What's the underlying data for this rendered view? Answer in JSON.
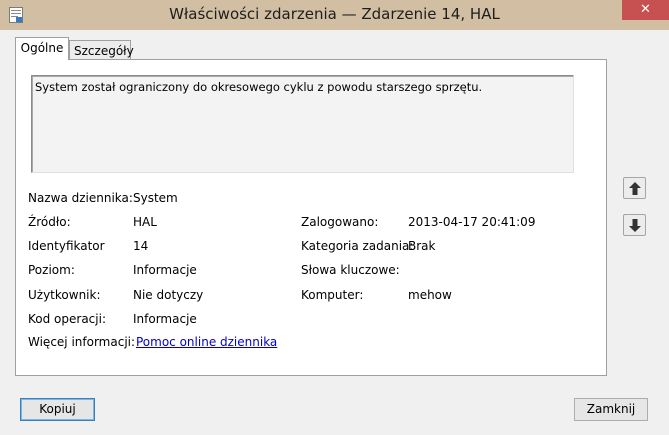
{
  "window": {
    "title": "Właściwości zdarzenia — Zdarzenie 14, HAL",
    "close_glyph": "✕"
  },
  "tabs": [
    {
      "label": "Ogólne"
    },
    {
      "label": "Szczegóły"
    }
  ],
  "description": "System został ograniczony do okresowego cyklu z powodu starszego sprzętu.",
  "fields_left": [
    {
      "label": "Nazwa dziennika:",
      "value": "System"
    },
    {
      "label": "Źródło:",
      "value": "HAL"
    },
    {
      "label": "Identyfikator",
      "value": "14"
    },
    {
      "label": "Poziom:",
      "value": "Informacje"
    },
    {
      "label": "Użytkownik:",
      "value": "Nie dotyczy"
    },
    {
      "label": "Kod operacji:",
      "value": "Informacje"
    },
    {
      "label": "Więcej informacji:",
      "value": "Pomoc online dziennika"
    }
  ],
  "fields_right": [
    {
      "label": "Zalogowano:",
      "value": "2013-04-17 20:41:09"
    },
    {
      "label": "Kategoria zadania:",
      "value": "Brak"
    },
    {
      "label": "Słowa kluczowe:",
      "value": ""
    },
    {
      "label": "Komputer:",
      "value": "mehow"
    }
  ],
  "buttons": {
    "copy": "Kopiuj",
    "close": "Zamknij"
  },
  "icons": {
    "window_icon": "event-properties-icon",
    "up": "arrow-up-icon",
    "down": "arrow-down-icon"
  },
  "colors": {
    "titlebar": "#d2bea3",
    "close": "#c75050",
    "link": "#0000cc"
  }
}
